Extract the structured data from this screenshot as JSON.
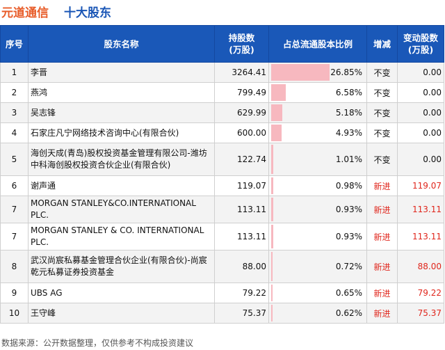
{
  "title": "元道通信",
  "subtitle": "十大股东",
  "table": {
    "headers": [
      "序号",
      "股东名称",
      "持股数（万股）",
      "占总流通股本比例",
      "增减",
      "变动股数（万股）"
    ],
    "headers_line1": [
      "序号",
      "股东名称",
      "持股数",
      "占总流通股本比例",
      "增减",
      "变动股数"
    ],
    "headers_line2": [
      "",
      "",
      "(万股)",
      "",
      "",
      "(万股)"
    ]
  },
  "colors": {
    "title": "#e85d2a",
    "subtitle": "#1a56b6",
    "header_bg": "#1a58b8",
    "bar": "#f7b8bf",
    "new_text": "#e0261c"
  },
  "chart_data": {
    "type": "table",
    "title": "十大股东",
    "columns": [
      "序号",
      "股东名称",
      "持股数(万股)",
      "占总流通股本比例",
      "增减",
      "变动股数(万股)"
    ],
    "rows": [
      {
        "rank": "1",
        "name": "李晋",
        "shares": "3264.41",
        "ratio": 26.85,
        "ratio_label": "26.85%",
        "change": "不变",
        "change_shares": "0.00"
      },
      {
        "rank": "2",
        "name": "燕鸿",
        "shares": "799.49",
        "ratio": 6.58,
        "ratio_label": "6.58%",
        "change": "不变",
        "change_shares": "0.00"
      },
      {
        "rank": "3",
        "name": "吴志锋",
        "shares": "629.99",
        "ratio": 5.18,
        "ratio_label": "5.18%",
        "change": "不变",
        "change_shares": "0.00"
      },
      {
        "rank": "4",
        "name": "石家庄凡宁网络技术咨询中心(有限合伙)",
        "shares": "600.00",
        "ratio": 4.93,
        "ratio_label": "4.93%",
        "change": "不变",
        "change_shares": "0.00"
      },
      {
        "rank": "5",
        "name": "海创天成(青岛)股权投资基金管理有限公司-潍坊中科海创股权投资合伙企业(有限合伙)",
        "shares": "122.74",
        "ratio": 1.01,
        "ratio_label": "1.01%",
        "change": "不变",
        "change_shares": "0.00"
      },
      {
        "rank": "6",
        "name": "谢声通",
        "shares": "119.07",
        "ratio": 0.98,
        "ratio_label": "0.98%",
        "change": "新进",
        "change_shares": "119.07"
      },
      {
        "rank": "7",
        "name": "MORGAN STANLEY&CO.INTERNATIONAL PLC.",
        "shares": "113.11",
        "ratio": 0.93,
        "ratio_label": "0.93%",
        "change": "新进",
        "change_shares": "113.11"
      },
      {
        "rank": "7",
        "name": "MORGAN STANLEY & CO. INTERNATIONAL PLC.",
        "shares": "113.11",
        "ratio": 0.93,
        "ratio_label": "0.93%",
        "change": "新进",
        "change_shares": "113.11"
      },
      {
        "rank": "8",
        "name": "武汉尚宸私募基金管理合伙企业(有限合伙)-尚宸乾元私募证券投资基金",
        "shares": "88.00",
        "ratio": 0.72,
        "ratio_label": "0.72%",
        "change": "新进",
        "change_shares": "88.00"
      },
      {
        "rank": "9",
        "name": "UBS AG",
        "shares": "79.22",
        "ratio": 0.65,
        "ratio_label": "0.65%",
        "change": "新进",
        "change_shares": "79.22"
      },
      {
        "rank": "10",
        "name": "王守峰",
        "shares": "75.37",
        "ratio": 0.62,
        "ratio_label": "0.62%",
        "change": "新进",
        "change_shares": "75.37"
      }
    ]
  },
  "footer": "数据来源：公开数据整理，仅供参考不构成投资建议"
}
